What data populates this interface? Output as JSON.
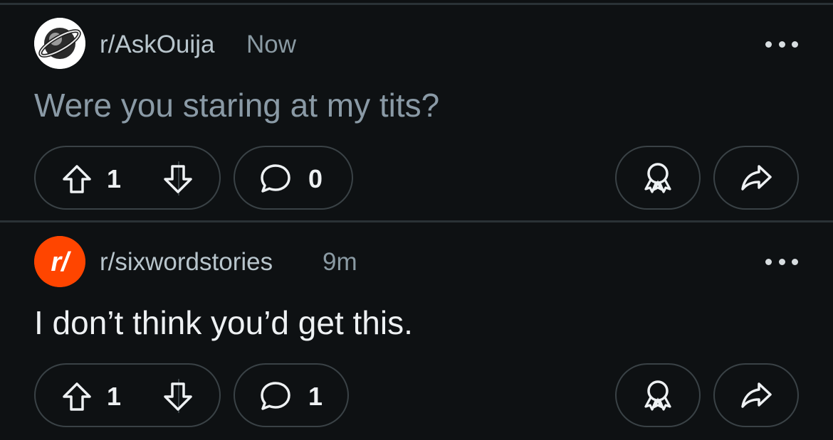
{
  "posts": [
    {
      "subreddit": "r/AskOuija",
      "time": "Now",
      "title": "Were you staring at my tits?",
      "title_color": "#8a9aa6",
      "upvotes": "1",
      "comments": "0",
      "avatar_icon": "ouija-planet-icon"
    },
    {
      "subreddit": "r/sixwordstories",
      "time": "9m",
      "title": "I don’t think you’d get this.",
      "title_color": "#eef1f3",
      "upvotes": "1",
      "comments": "1",
      "avatar_icon": "reddit-r-slash-icon",
      "avatar_letter": "r/",
      "avatar_color": "#ff4500"
    }
  ]
}
